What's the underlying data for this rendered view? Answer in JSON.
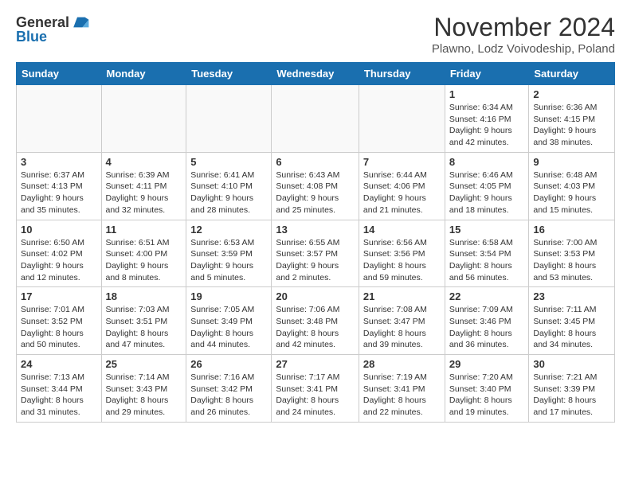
{
  "logo": {
    "text_general": "General",
    "text_blue": "Blue"
  },
  "title": "November 2024",
  "location": "Plawno, Lodz Voivodeship, Poland",
  "headers": [
    "Sunday",
    "Monday",
    "Tuesday",
    "Wednesday",
    "Thursday",
    "Friday",
    "Saturday"
  ],
  "weeks": [
    [
      {
        "day": "",
        "info": ""
      },
      {
        "day": "",
        "info": ""
      },
      {
        "day": "",
        "info": ""
      },
      {
        "day": "",
        "info": ""
      },
      {
        "day": "",
        "info": ""
      },
      {
        "day": "1",
        "info": "Sunrise: 6:34 AM\nSunset: 4:16 PM\nDaylight: 9 hours\nand 42 minutes."
      },
      {
        "day": "2",
        "info": "Sunrise: 6:36 AM\nSunset: 4:15 PM\nDaylight: 9 hours\nand 38 minutes."
      }
    ],
    [
      {
        "day": "3",
        "info": "Sunrise: 6:37 AM\nSunset: 4:13 PM\nDaylight: 9 hours\nand 35 minutes."
      },
      {
        "day": "4",
        "info": "Sunrise: 6:39 AM\nSunset: 4:11 PM\nDaylight: 9 hours\nand 32 minutes."
      },
      {
        "day": "5",
        "info": "Sunrise: 6:41 AM\nSunset: 4:10 PM\nDaylight: 9 hours\nand 28 minutes."
      },
      {
        "day": "6",
        "info": "Sunrise: 6:43 AM\nSunset: 4:08 PM\nDaylight: 9 hours\nand 25 minutes."
      },
      {
        "day": "7",
        "info": "Sunrise: 6:44 AM\nSunset: 4:06 PM\nDaylight: 9 hours\nand 21 minutes."
      },
      {
        "day": "8",
        "info": "Sunrise: 6:46 AM\nSunset: 4:05 PM\nDaylight: 9 hours\nand 18 minutes."
      },
      {
        "day": "9",
        "info": "Sunrise: 6:48 AM\nSunset: 4:03 PM\nDaylight: 9 hours\nand 15 minutes."
      }
    ],
    [
      {
        "day": "10",
        "info": "Sunrise: 6:50 AM\nSunset: 4:02 PM\nDaylight: 9 hours\nand 12 minutes."
      },
      {
        "day": "11",
        "info": "Sunrise: 6:51 AM\nSunset: 4:00 PM\nDaylight: 9 hours\nand 8 minutes."
      },
      {
        "day": "12",
        "info": "Sunrise: 6:53 AM\nSunset: 3:59 PM\nDaylight: 9 hours\nand 5 minutes."
      },
      {
        "day": "13",
        "info": "Sunrise: 6:55 AM\nSunset: 3:57 PM\nDaylight: 9 hours\nand 2 minutes."
      },
      {
        "day": "14",
        "info": "Sunrise: 6:56 AM\nSunset: 3:56 PM\nDaylight: 8 hours\nand 59 minutes."
      },
      {
        "day": "15",
        "info": "Sunrise: 6:58 AM\nSunset: 3:54 PM\nDaylight: 8 hours\nand 56 minutes."
      },
      {
        "day": "16",
        "info": "Sunrise: 7:00 AM\nSunset: 3:53 PM\nDaylight: 8 hours\nand 53 minutes."
      }
    ],
    [
      {
        "day": "17",
        "info": "Sunrise: 7:01 AM\nSunset: 3:52 PM\nDaylight: 8 hours\nand 50 minutes."
      },
      {
        "day": "18",
        "info": "Sunrise: 7:03 AM\nSunset: 3:51 PM\nDaylight: 8 hours\nand 47 minutes."
      },
      {
        "day": "19",
        "info": "Sunrise: 7:05 AM\nSunset: 3:49 PM\nDaylight: 8 hours\nand 44 minutes."
      },
      {
        "day": "20",
        "info": "Sunrise: 7:06 AM\nSunset: 3:48 PM\nDaylight: 8 hours\nand 42 minutes."
      },
      {
        "day": "21",
        "info": "Sunrise: 7:08 AM\nSunset: 3:47 PM\nDaylight: 8 hours\nand 39 minutes."
      },
      {
        "day": "22",
        "info": "Sunrise: 7:09 AM\nSunset: 3:46 PM\nDaylight: 8 hours\nand 36 minutes."
      },
      {
        "day": "23",
        "info": "Sunrise: 7:11 AM\nSunset: 3:45 PM\nDaylight: 8 hours\nand 34 minutes."
      }
    ],
    [
      {
        "day": "24",
        "info": "Sunrise: 7:13 AM\nSunset: 3:44 PM\nDaylight: 8 hours\nand 31 minutes."
      },
      {
        "day": "25",
        "info": "Sunrise: 7:14 AM\nSunset: 3:43 PM\nDaylight: 8 hours\nand 29 minutes."
      },
      {
        "day": "26",
        "info": "Sunrise: 7:16 AM\nSunset: 3:42 PM\nDaylight: 8 hours\nand 26 minutes."
      },
      {
        "day": "27",
        "info": "Sunrise: 7:17 AM\nSunset: 3:41 PM\nDaylight: 8 hours\nand 24 minutes."
      },
      {
        "day": "28",
        "info": "Sunrise: 7:19 AM\nSunset: 3:41 PM\nDaylight: 8 hours\nand 22 minutes."
      },
      {
        "day": "29",
        "info": "Sunrise: 7:20 AM\nSunset: 3:40 PM\nDaylight: 8 hours\nand 19 minutes."
      },
      {
        "day": "30",
        "info": "Sunrise: 7:21 AM\nSunset: 3:39 PM\nDaylight: 8 hours\nand 17 minutes."
      }
    ]
  ]
}
